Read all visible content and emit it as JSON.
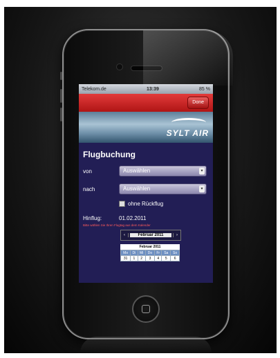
{
  "status": {
    "carrier": "Telekom.de",
    "time": "13:39",
    "battery": "85 %"
  },
  "nav": {
    "done": "Done"
  },
  "banner": {
    "logo": "SYLT AIR"
  },
  "form": {
    "heading": "Flugbuchung",
    "from_label": "von",
    "from_value": "Auswählen",
    "to_label": "nach",
    "to_value": "Auswählen",
    "no_return_label": "ohne Rückflug",
    "outbound_label": "Hinflug:",
    "outbound_date": "01.02.2011",
    "hint": "Bitte wählen Sie Ihren Flugtag aus dem Kalender"
  },
  "calendar": {
    "month_label": "Februar 2011",
    "title": "Februar 2011",
    "prev": "‹",
    "next": "›",
    "weekdays": [
      "Mo",
      "Di",
      "Mi",
      "Do",
      "Fr",
      "Sa",
      "So"
    ],
    "week1": [
      "31",
      "1",
      "2",
      "3",
      "4",
      "5",
      "6"
    ]
  }
}
